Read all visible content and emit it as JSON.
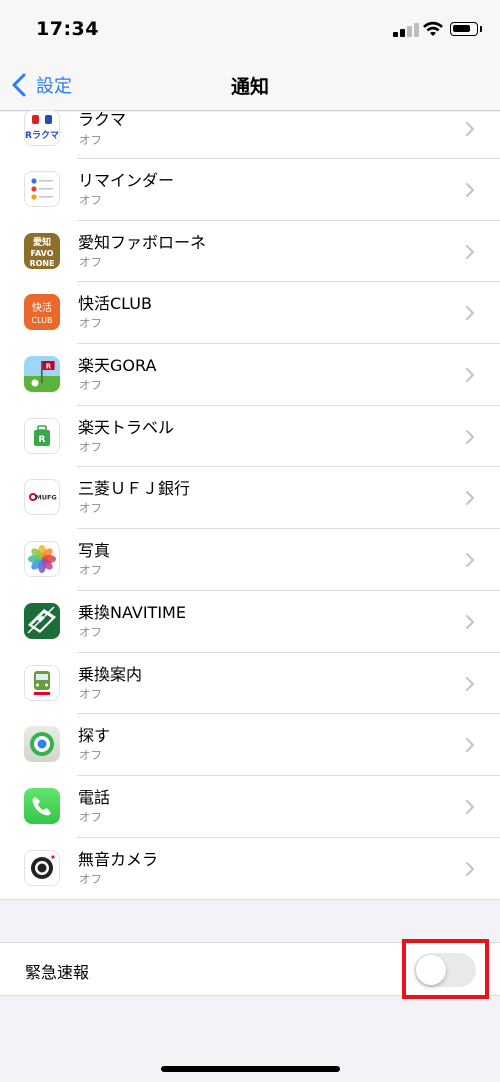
{
  "status_bar": {
    "time": "17:34"
  },
  "nav": {
    "back_label": "設定",
    "title": "通知"
  },
  "apps": [
    {
      "name": "ラクマ",
      "status": "オフ",
      "icon": "rakuma-icon",
      "icon_text": "Rラクマ"
    },
    {
      "name": "リマインダー",
      "status": "オフ",
      "icon": "reminders-icon"
    },
    {
      "name": "愛知ファボローネ",
      "status": "オフ",
      "icon": "aichi-favorone-icon",
      "icon_text": "愛知 FAVO RONE"
    },
    {
      "name": "快活CLUB",
      "status": "オフ",
      "icon": "kaikatsu-club-icon",
      "icon_text": "快活 CLUB"
    },
    {
      "name": "楽天GORA",
      "status": "オフ",
      "icon": "rakuten-gora-icon"
    },
    {
      "name": "楽天トラベル",
      "status": "オフ",
      "icon": "rakuten-travel-icon"
    },
    {
      "name": "三菱ＵＦＪ銀行",
      "status": "オフ",
      "icon": "mufg-icon",
      "icon_text": "MUFG"
    },
    {
      "name": "写真",
      "status": "オフ",
      "icon": "photos-icon"
    },
    {
      "name": "乗換NAVITIME",
      "status": "オフ",
      "icon": "navitime-icon"
    },
    {
      "name": "乗換案内",
      "status": "オフ",
      "icon": "norikae-annai-icon"
    },
    {
      "name": "探す",
      "status": "オフ",
      "icon": "find-my-icon"
    },
    {
      "name": "電話",
      "status": "オフ",
      "icon": "phone-icon"
    },
    {
      "name": "無音カメラ",
      "status": "オフ",
      "icon": "silent-camera-icon"
    }
  ],
  "emergency": {
    "label": "緊急速報",
    "toggle_on": false
  },
  "colors": {
    "accent": "#2a7ef0",
    "highlight": "#e8121b",
    "secondary_text": "#8e8e93"
  }
}
